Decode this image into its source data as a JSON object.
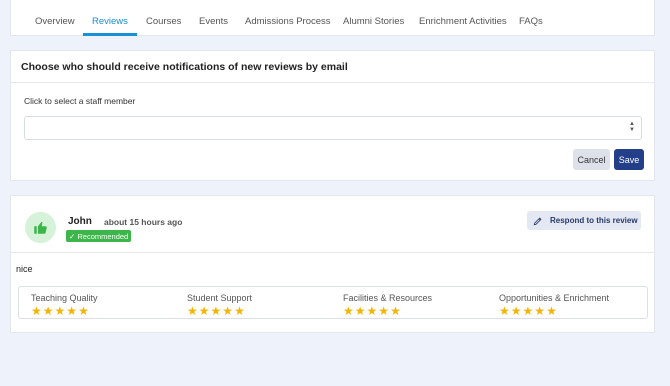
{
  "tabs": [
    {
      "label": "Overview"
    },
    {
      "label": "Reviews"
    },
    {
      "label": "Courses"
    },
    {
      "label": "Events"
    },
    {
      "label": "Admissions Process"
    },
    {
      "label": "Alumni Stories"
    },
    {
      "label": "Enrichment Activities"
    },
    {
      "label": "FAQs"
    }
  ],
  "active_tab": "Reviews",
  "notifications": {
    "title": "Choose who should receive notifications of new reviews by email",
    "staff_label": "Click to select a staff member",
    "staff_select_value": "",
    "cancel_label": "Cancel",
    "save_label": "Save"
  },
  "review": {
    "reviewer": "John",
    "time": "about 15 hours ago",
    "badge": "✓ Recommended",
    "respond_label": "Respond to this review",
    "comment": "nice",
    "ratings": [
      {
        "label": "Teaching Quality",
        "stars": 5
      },
      {
        "label": "Student Support",
        "stars": 5
      },
      {
        "label": "Facilities & Resources",
        "stars": 5
      },
      {
        "label": "Opportunities & Enrichment",
        "stars": 5
      }
    ]
  },
  "colors": {
    "accent": "#1a8fd6",
    "primary_button": "#243f8a",
    "recommended": "#3cb54a",
    "star": "#f4b400",
    "page_bg": "#eef2fb"
  }
}
